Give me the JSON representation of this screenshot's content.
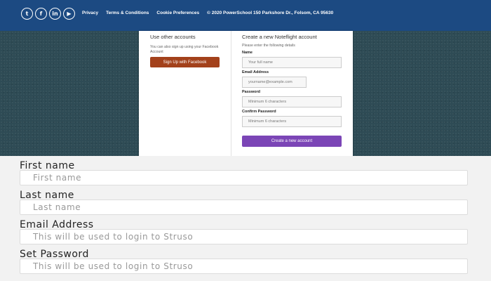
{
  "footer": {
    "social": [
      {
        "icon": "twitter-icon",
        "glyph": "t"
      },
      {
        "icon": "facebook-icon",
        "glyph": "f"
      },
      {
        "icon": "linkedin-icon",
        "glyph": "in"
      },
      {
        "icon": "youtube-icon",
        "glyph": "▶"
      }
    ],
    "links": [
      "Privacy",
      "Terms & Conditions",
      "Cookie Preferences"
    ],
    "copyright": "© 2020 PowerSchool 150 Parkshore Dr., Folsom, CA 95630",
    "color": "#1c4a82"
  },
  "card": {
    "left": {
      "heading": "Use other accounts",
      "text": "You can also sign up using your Facebook Account",
      "facebook_button": "Sign Up with Facebook",
      "facebook_color": "#a3411b"
    },
    "right": {
      "heading": "Create a new Noteflight account",
      "intro": "Please enter the following details",
      "fields": [
        {
          "label": "Name",
          "placeholder": "Your full name"
        },
        {
          "label": "Email Address",
          "placeholder": "yourname@example.com"
        },
        {
          "label": "Password",
          "placeholder": "Minimum 6 characters"
        },
        {
          "label": "Confirm Password",
          "placeholder": "Minimum 6 characters"
        }
      ],
      "create_button": "Create a new account",
      "create_color": "#7b45b6"
    }
  },
  "form": {
    "first_name": {
      "label": "First name",
      "placeholder": "First name"
    },
    "last_name": {
      "label": "Last name",
      "placeholder": "Last name"
    },
    "email": {
      "label": "Email Address",
      "placeholder": "This will be used to login to Struso"
    },
    "password": {
      "label": "Set Password",
      "placeholder": "This will be used to login to Struso"
    }
  }
}
